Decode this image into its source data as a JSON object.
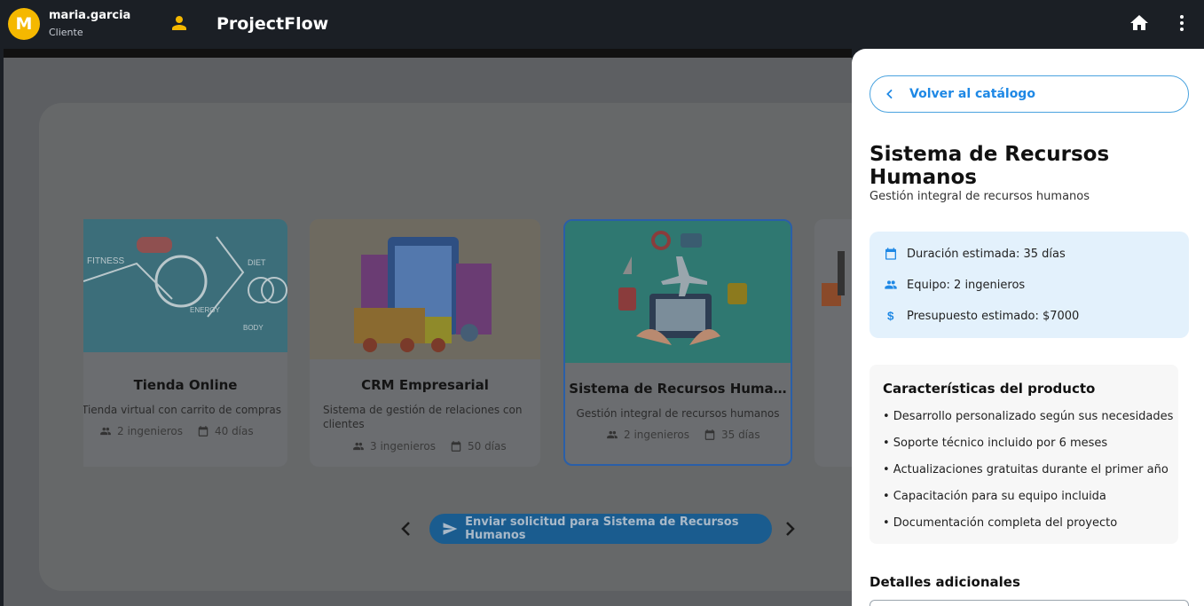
{
  "header": {
    "avatar_letter": "M",
    "user_name": "maria.garcia",
    "user_role": "Cliente",
    "brand": "ProjectFlow",
    "icons": [
      "person-icon",
      "home-icon",
      "more-vert-icon"
    ]
  },
  "catalog": {
    "cards": [
      {
        "title": "Tienda Online",
        "description": "Tienda virtual con carrito de compras",
        "team": "2 ingenieros",
        "duration": "40 días"
      },
      {
        "title": "CRM Empresarial",
        "description": "Sistema de gestión de relaciones con clientes",
        "team": "3 ingenieros",
        "duration": "50 días"
      },
      {
        "title": "Sistema de Recursos Huma…",
        "description": "Gestión integral de recursos humanos",
        "team": "2 ingenieros",
        "duration": "35 días"
      }
    ],
    "send_button": "Enviar solicitud para Sistema de Recursos Humanos"
  },
  "drawer": {
    "back_label": "Volver al catálogo",
    "title": "Sistema de Recursos Humanos",
    "subtitle": "Gestión integral de recursos humanos",
    "info": {
      "duration": "Duración estimada: 35 días",
      "team": "Equipo: 2 ingenieros",
      "budget": "Presupuesto estimado: $7000"
    },
    "features_title": "Características del producto",
    "features": [
      "• Desarrollo personalizado según sus necesidades",
      "• Soporte técnico incluido por 6 meses",
      "• Actualizaciones gratuitas durante el primer año",
      "• Capacitación para su equipo incluida",
      "• Documentación completa del proyecto"
    ],
    "extra_title": "Detalles adicionales"
  },
  "colors": {
    "accent": "#1e88e5",
    "avatar": "#f5b800",
    "info_bg": "#e3f1fc",
    "header_bg": "#1b1f25"
  }
}
